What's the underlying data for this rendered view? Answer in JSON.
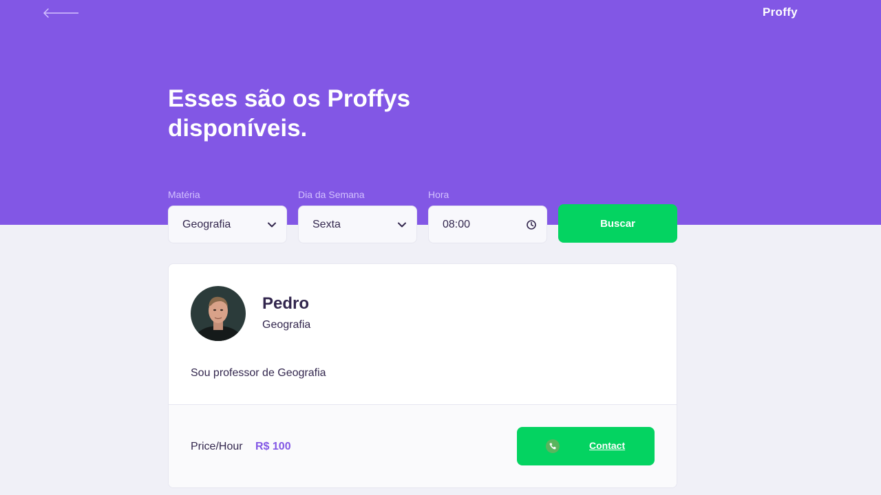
{
  "header": {
    "logo": "Proffy",
    "title": "Esses são os Proffys disponíveis."
  },
  "search": {
    "subject": {
      "label": "Matéria",
      "value": "Geografia"
    },
    "weekday": {
      "label": "Dia da Semana",
      "value": "Sexta"
    },
    "time": {
      "label": "Hora",
      "value": "08:00"
    },
    "submit_label": "Buscar"
  },
  "teacher": {
    "name": "Pedro",
    "subject": "Geografia",
    "bio": "Sou professor de Geografia",
    "price_label": "Price/Hour",
    "price_value": "R$ 100",
    "contact_label": "Contact"
  },
  "icons": {
    "back": "arrow-left-icon",
    "select": "chevron-down-icon",
    "time": "clock-icon",
    "contact": "whatsapp-icon"
  },
  "colors": {
    "primary": "#8257E5",
    "secondary": "#04D361",
    "background": "#F0F0F7",
    "text": "#32264D"
  }
}
